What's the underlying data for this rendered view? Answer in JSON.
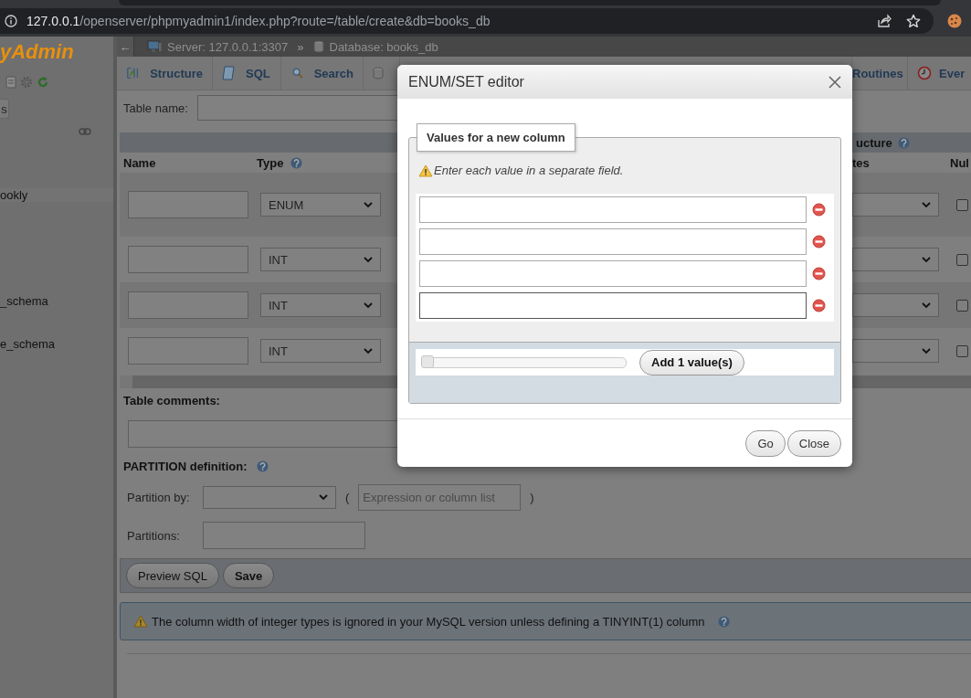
{
  "browser": {
    "url_host": "127.0.0.1",
    "url_path": "/openserver/phpmyadmin1/index.php?route=/table/create&db=books_db"
  },
  "sidebar": {
    "logo": "yAdmin",
    "button": "s",
    "items": [
      "ookly",
      "_schema",
      "e_schema"
    ]
  },
  "breadcrumb": {
    "back": "←",
    "server": "Server: 127.0.0.1:3307",
    "separator": "»",
    "database": "Database: books_db"
  },
  "tabs": [
    {
      "label": "Structure",
      "selected": false
    },
    {
      "label": "SQL",
      "selected": false
    },
    {
      "label": "Search",
      "selected": false
    },
    {
      "selected": false
    },
    {
      "label": "Routines",
      "selected": false
    },
    {
      "label": "Ever",
      "selected": false
    }
  ],
  "table_name": {
    "label": "Table name:"
  },
  "columns": {
    "name": "Name",
    "type": "Type",
    "structure": "ucture",
    "attributes": "tes",
    "null": "Nul"
  },
  "rows": [
    {
      "type": "ENUM",
      "null": false
    },
    {
      "type": "INT",
      "null": false
    },
    {
      "type": "INT",
      "null": false
    },
    {
      "type": "INT",
      "null": false
    }
  ],
  "table_comments": {
    "label": "Table comments:"
  },
  "partition": {
    "title": "PARTITION definition:",
    "by_label": "Partition by:",
    "open": "(",
    "placeholder": "Expression or column list",
    "close": ")",
    "partitions_label": "Partitions:"
  },
  "buttons": [
    "Preview SQL",
    "Save"
  ],
  "warning": "The column width of integer types is ignored in your MySQL version unless defining a TINYINT(1) column",
  "dialog": {
    "title": "ENUM/SET editor",
    "legend": "Values for a new column",
    "hint": "Enter each value in a separate field.",
    "values": [
      {
        "focused": false
      },
      {
        "focused": false
      },
      {
        "focused": false
      },
      {
        "focused": true
      }
    ],
    "slider": {
      "level": 0
    },
    "add_button": "Add 1 value(s)",
    "buttons": [
      "Go",
      "Close"
    ]
  }
}
